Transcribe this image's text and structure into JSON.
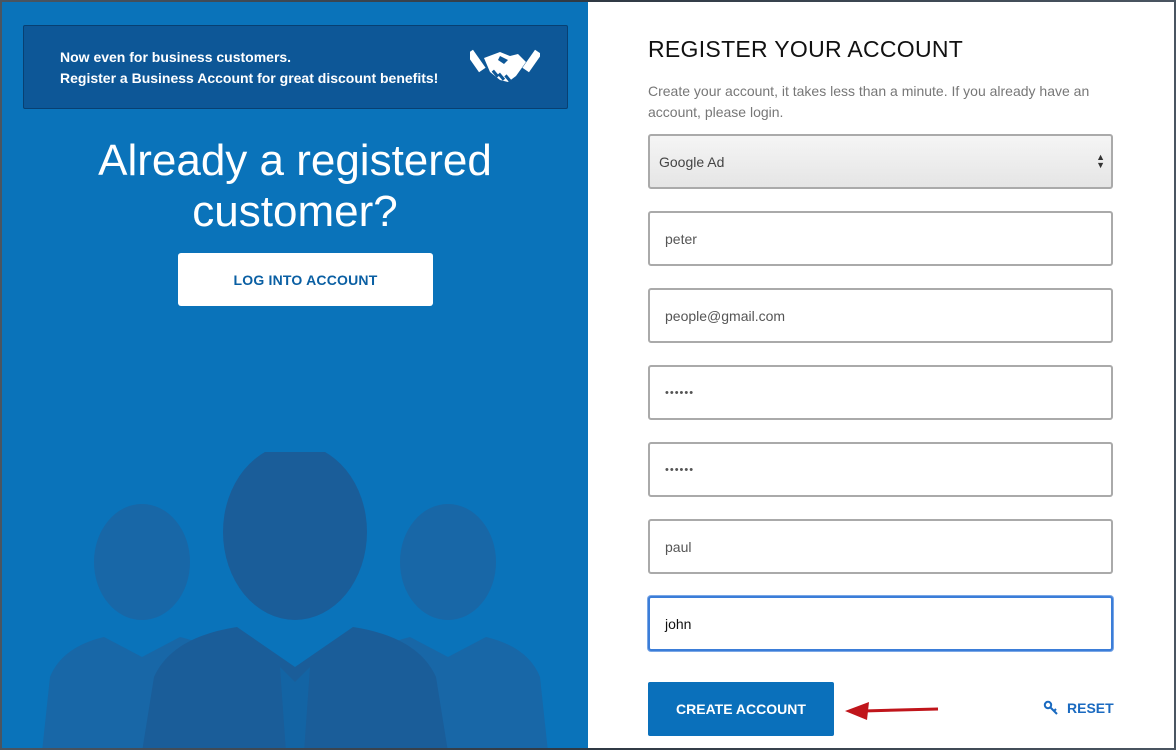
{
  "promo": {
    "line1": "Now even for business customers.",
    "line2": "Register a Business Account for great discount benefits!",
    "icon": "handshake-icon"
  },
  "login_section": {
    "title": "Already a registered customer?",
    "button_label": "LOG INTO ACCOUNT"
  },
  "register": {
    "title": "REGISTER YOUR ACCOUNT",
    "description": "Create your account, it takes less than a minute. If you already have an account, please login.",
    "fields": {
      "source_select": "Google Ad",
      "first_name": "peter",
      "email": "people@gmail.com",
      "password": "••••••",
      "password_confirm": "••••••",
      "field_6": "paul",
      "field_7": "john"
    },
    "create_label": "CREATE ACCOUNT",
    "reset_label": "RESET"
  },
  "colors": {
    "panel_blue": "#0a73ba",
    "promo_blue": "#0d5797",
    "button_blue": "#0a70bb",
    "arrow_red": "#c0151b"
  }
}
